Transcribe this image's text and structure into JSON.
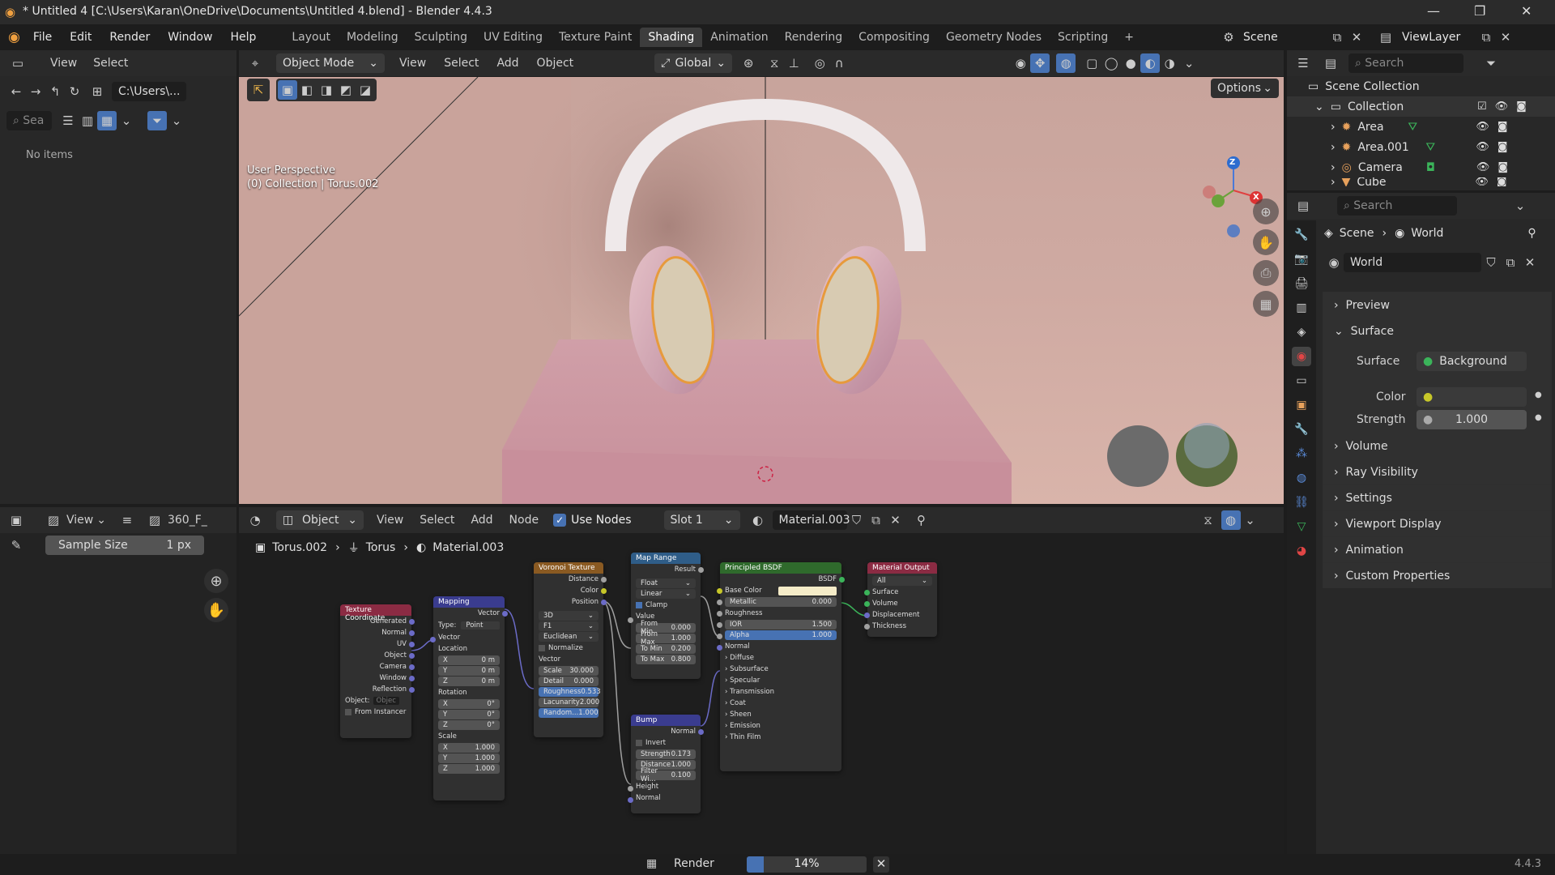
{
  "window": {
    "title": "* Untitled 4 [C:\\Users\\Karan\\OneDrive\\Documents\\Untitled 4.blend] - Blender 4.4.3",
    "minimize": "—",
    "maximize": "❐",
    "close": "✕"
  },
  "menu": [
    "File",
    "Edit",
    "Render",
    "Window",
    "Help"
  ],
  "workspaces": [
    "Layout",
    "Modeling",
    "Sculpting",
    "UV Editing",
    "Texture Paint",
    "Shading",
    "Animation",
    "Rendering",
    "Compositing",
    "Geometry Nodes",
    "Scripting",
    "+"
  ],
  "active_workspace": "Shading",
  "scene": {
    "name": "Scene",
    "view_layer": "ViewLayer"
  },
  "file_browser": {
    "menu": [
      "View",
      "Select"
    ],
    "path": "C:\\Users\\...",
    "search_placeholder": "Sea",
    "empty_text": "No items"
  },
  "image_editor": {
    "view_label": "View",
    "image_name": "360_F_",
    "sample_size_label": "Sample Size",
    "sample_size_value": "1 px"
  },
  "viewport": {
    "mode": "Object Mode",
    "menus": [
      "View",
      "Select",
      "Add",
      "Object"
    ],
    "orientation": "Global",
    "options_label": "Options",
    "perspective_text": "User Perspective",
    "collection_text": "(0) Collection | Torus.002",
    "gizmo": {
      "x": "X",
      "y": "Y",
      "z": "Z"
    }
  },
  "node_editor": {
    "type_label": "Object",
    "menus": [
      "View",
      "Select",
      "Add",
      "Node"
    ],
    "use_nodes_label": "Use Nodes",
    "slot": "Slot 1",
    "material": "Material.003",
    "breadcrumb": [
      "Torus.002",
      "Torus",
      "Material.003"
    ],
    "nodes": {
      "texcoord": {
        "title": "Texture Coordinate",
        "outputs": [
          "Generated",
          "Normal",
          "UV",
          "Object",
          "Camera",
          "Window",
          "Reflection"
        ],
        "object_label": "Object:",
        "object_placeholder": "Objec",
        "instancer": "From Instancer"
      },
      "mapping": {
        "title": "Mapping",
        "output": "Vector",
        "type_label": "Type:",
        "type_value": "Point",
        "vector": "Vector",
        "location": "Location",
        "loc": [
          [
            "X",
            "0 m"
          ],
          [
            "Y",
            "0 m"
          ],
          [
            "Z",
            "0 m"
          ]
        ],
        "rotation": "Rotation",
        "rot": [
          [
            "X",
            "0°"
          ],
          [
            "Y",
            "0°"
          ],
          [
            "Z",
            "0°"
          ]
        ],
        "scale": "Scale",
        "scl": [
          [
            "X",
            "1.000"
          ],
          [
            "Y",
            "1.000"
          ],
          [
            "Z",
            "1.000"
          ]
        ]
      },
      "voronoi": {
        "title": "Voronoi Texture",
        "outputs": [
          "Distance",
          "Color",
          "Position"
        ],
        "dim": "3D",
        "feature": "F1",
        "metric": "Euclidean",
        "normalize": "Normalize",
        "vector": "Vector",
        "fields": [
          [
            "Scale",
            "30.000"
          ],
          [
            "Detail",
            "0.000"
          ],
          [
            "Roughness",
            "0.533"
          ],
          [
            "Lacunarity",
            "2.000"
          ],
          [
            "Random...",
            "1.000"
          ]
        ]
      },
      "maprange": {
        "title": "Map Range",
        "output": "Result",
        "dtype": "Float",
        "interp": "Linear",
        "clamp": "Clamp",
        "value": "Value",
        "fields": [
          [
            "From Min",
            "0.000"
          ],
          [
            "From Max",
            "1.000"
          ],
          [
            "To Min",
            "0.200"
          ],
          [
            "To Max",
            "0.800"
          ]
        ]
      },
      "bump": {
        "title": "Bump",
        "output": "Normal",
        "invert": "Invert",
        "fields": [
          [
            "Strength",
            "0.173"
          ],
          [
            "Distance",
            "1.000"
          ],
          [
            "Filter Wi...",
            "0.100"
          ]
        ],
        "inputs": [
          "Height",
          "Normal"
        ]
      },
      "bsdf": {
        "title": "Principled BSDF",
        "output": "BSDF",
        "base_color": "Base Color",
        "fields": [
          [
            "Metallic",
            "0.000"
          ]
        ],
        "roughness": "Roughness",
        "fields2": [
          [
            "IOR",
            "1.500"
          ],
          [
            "Alpha",
            "1.000"
          ]
        ],
        "normal": "Normal",
        "panels": [
          "Diffuse",
          "Subsurface",
          "Specular",
          "Transmission",
          "Coat",
          "Sheen",
          "Emission",
          "Thin Film"
        ]
      },
      "output": {
        "title": "Material Output",
        "target": "All",
        "inputs": [
          "Surface",
          "Volume",
          "Displacement",
          "Thickness"
        ]
      }
    }
  },
  "outliner": {
    "search_placeholder": "Search",
    "root": "Scene Collection",
    "collection": "Collection",
    "items": [
      "Area",
      "Area.001",
      "Camera",
      "Cube"
    ]
  },
  "properties": {
    "search_placeholder": "Search",
    "breadcrumb": [
      "Scene",
      "World"
    ],
    "world_name": "World",
    "panels_top": [
      "Preview"
    ],
    "surface_panel": "Surface",
    "surface_label": "Surface",
    "surface_value": "Background",
    "color_label": "Color",
    "strength_label": "Strength",
    "strength_value": "1.000",
    "panels_bottom": [
      "Volume",
      "Ray Visibility",
      "Settings",
      "Viewport Display",
      "Animation",
      "Custom Properties"
    ]
  },
  "statusbar": {
    "render_label": "Render",
    "progress_text": "14%",
    "progress": 0.14,
    "version": "4.4.3"
  },
  "colors": {
    "accent_blue": "#4772b3",
    "texcoord_header": "#8b2b43",
    "mapping_header": "#3a3c8f",
    "voronoi_header": "#8a5a22",
    "maprange_header": "#2f5d88",
    "bump_header": "#3a3c8f",
    "bsdf_header": "#2f6a2c",
    "output_header": "#8b2b43"
  }
}
